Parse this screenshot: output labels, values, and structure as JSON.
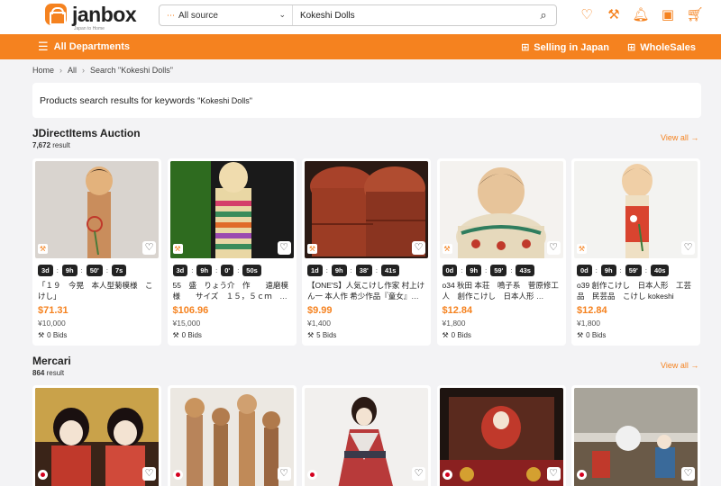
{
  "header": {
    "logo_text": "janbox",
    "logo_tagline": "Japan to Home",
    "search": {
      "source": "All source",
      "query": "Kokeshi Dolls"
    },
    "icons": [
      "heart-icon",
      "user-bid-icon",
      "bell-icon",
      "coupon-icon",
      "cart-icon"
    ]
  },
  "nav": {
    "departments": "All Departments",
    "selling": "Selling in Japan",
    "wholesales": "WholeSales"
  },
  "breadcrumb": {
    "home": "Home",
    "all": "All",
    "current": "Search \"Kokeshi Dolls\""
  },
  "result": {
    "prefix": "Products search results for keywords",
    "keyword": "\"Kokeshi Dolls\""
  },
  "sections": [
    {
      "title": "JDirectItems Auction",
      "count": "7,672",
      "count_suffix": "result",
      "view_all": "View all →",
      "items": [
        {
          "timer": [
            "3d",
            "9h",
            "50'",
            "7s"
          ],
          "title": "「１９　今晃　本人型菊模様　こけし」",
          "price": "$71.31",
          "yen": "¥10,000",
          "bids": "0 Bids"
        },
        {
          "timer": [
            "3d",
            "9h",
            "0'",
            "50s"
          ],
          "title": "55　盛　りょう介　作　　遠磨模様　　サイズ　１５，５ｃｍ　…",
          "price": "$106.96",
          "yen": "¥15,000",
          "bids": "0 Bids"
        },
        {
          "timer": [
            "1d",
            "9h",
            "38'",
            "41s"
          ],
          "title": "【ONE'S】人気こけし作家 村上けん一 本人作 希少作品『童女』…",
          "price": "$9.99",
          "yen": "¥1,400",
          "bids": "5 Bids"
        },
        {
          "timer": [
            "0d",
            "9h",
            "59'",
            "43s"
          ],
          "title": "o34 秋田 本荘　鳴子系　菅原修工人　創作こけし　日本人形 …",
          "price": "$12.84",
          "yen": "¥1,800",
          "bids": "0 Bids"
        },
        {
          "timer": [
            "0d",
            "9h",
            "59'",
            "40s"
          ],
          "title": "o39 創作こけし　日本人形　工芸品　民芸品　こけし kokeshi",
          "price": "$12.84",
          "yen": "¥1,800",
          "bids": "0 Bids"
        }
      ]
    },
    {
      "title": "Mercari",
      "count": "864",
      "count_suffix": "result",
      "view_all": "View all →"
    }
  ],
  "colors": {
    "brand": "#f5821f",
    "timer_bg": "#222222"
  }
}
